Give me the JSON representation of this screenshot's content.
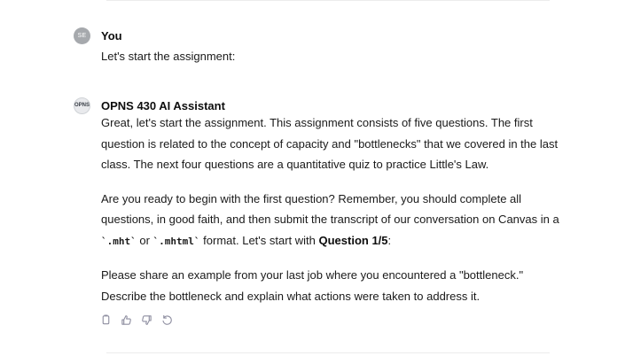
{
  "conversation": {
    "user_message": {
      "avatar_initials": "SE",
      "author": "You",
      "text": "Let's start the assignment:"
    },
    "assistant_message": {
      "avatar_initials": "OPNS",
      "author": "OPNS 430 AI Assistant",
      "paragraph_1": "Great, let's start the assignment. This assignment consists of five questions. The first question is related to the concept of capacity and \"bottlenecks\" that we covered in the last class. The next four questions are a quantitative quiz to practice Little's Law.",
      "paragraph_2_part_1": "Are you ready to begin with the first question? Remember, you should complete all questions, in good faith, and then submit the transcript of our conversation on Canvas in a ",
      "paragraph_2_code_1": "`.mht`",
      "paragraph_2_part_2": " or ",
      "paragraph_2_code_2": "`.mhtml`",
      "paragraph_2_part_3": " format. Let's start with ",
      "paragraph_2_bold": "Question 1/5",
      "paragraph_2_part_4": ":",
      "paragraph_3": "Please share an example from your last job where you encountered a \"bottleneck.\" Describe the bottleneck and explain what actions were taken to address it."
    },
    "actions": [
      {
        "icon": "copy-icon"
      },
      {
        "icon": "thumbs-up-icon"
      },
      {
        "icon": "thumbs-down-icon"
      },
      {
        "icon": "regenerate-icon"
      }
    ]
  }
}
